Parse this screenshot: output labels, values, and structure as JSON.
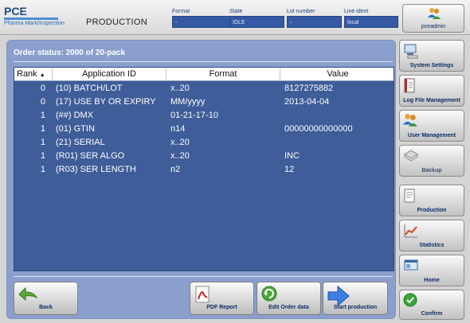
{
  "header": {
    "logo": "PCE",
    "logo_sub": "Pharma Mark/Inspection",
    "title": "PRODUCTION",
    "fields": [
      {
        "label": "Format",
        "value": "-"
      },
      {
        "label": "State",
        "value": "IDLE"
      },
      {
        "label": "Lot number",
        "value": "-"
      },
      {
        "label": "Line ident",
        "value": "local"
      }
    ],
    "user": "pceadmin"
  },
  "panel": {
    "title": "Order status: 2000 of 20-pack",
    "columns": [
      "Rank",
      "Application ID",
      "Format",
      "Value"
    ],
    "rows": [
      {
        "rank": "0",
        "app_id": "(10) BATCH/LOT",
        "format": "x..20",
        "value": "8127275882"
      },
      {
        "rank": "0",
        "app_id": "(17) USE BY OR EXPIRY",
        "format": "MM/yyyy",
        "value": "2013-04-04"
      },
      {
        "rank": "1",
        "app_id": "(##) DMX",
        "format": "01-21-17-10",
        "value": ""
      },
      {
        "rank": "1",
        "app_id": "(01) GTIN",
        "format": "n14",
        "value": "00000000000000"
      },
      {
        "rank": "1",
        "app_id": "(21) SERIAL",
        "format": "x..20",
        "value": ""
      },
      {
        "rank": "1",
        "app_id": "(R01) SER ALGO",
        "format": "x..20",
        "value": "INC"
      },
      {
        "rank": "1",
        "app_id": "(R03) SER LENGTH",
        "format": "n2",
        "value": "12"
      }
    ]
  },
  "bottom_buttons": {
    "back": "Back",
    "pdf_report": "PDF Report",
    "edit_order": "Edit Order data",
    "start_production": "Start production"
  },
  "side_buttons": [
    {
      "label": "System Settings",
      "icon": "computer-icon"
    },
    {
      "label": "Log File Management",
      "icon": "logfile-icon"
    },
    {
      "label": "User Management",
      "icon": "users-icon"
    },
    {
      "label": "Backup",
      "icon": "backup-icon"
    },
    {
      "label": "Production",
      "icon": "production-icon"
    },
    {
      "label": "Statistics",
      "icon": "statistics-icon"
    },
    {
      "label": "Home",
      "icon": "home-icon"
    },
    {
      "label": "Confirm",
      "icon": "confirm-icon"
    }
  ],
  "colors": {
    "panel": "#8b9fcc",
    "table": "#3f5d99",
    "field": "#3559a5",
    "label_text": "#0c2c66"
  }
}
